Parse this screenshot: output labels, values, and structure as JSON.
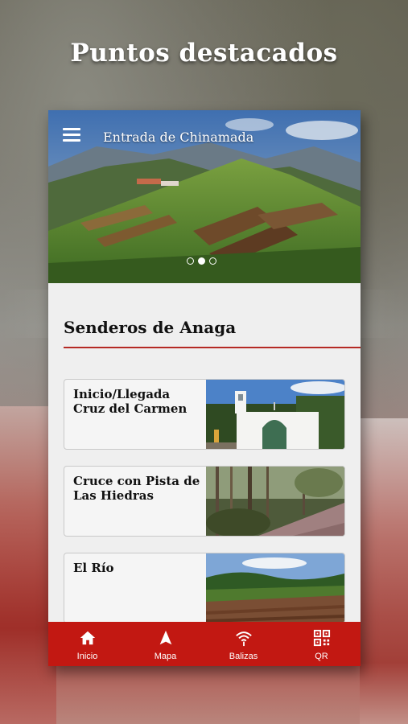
{
  "page": {
    "heading": "Puntos destacados"
  },
  "header": {
    "title": "Entrada de Chinamada",
    "menu_icon": "menu-icon"
  },
  "carousel": {
    "count": 3,
    "active_index": 1
  },
  "section": {
    "title": "Senderos de Anaga"
  },
  "cards": [
    {
      "title": "Inicio/Llegada Cruz del Carmen",
      "image": "chapel-image"
    },
    {
      "title": "Cruce con Pista de Las Hiedras",
      "image": "forest-path-image"
    },
    {
      "title": "El Río",
      "image": "terraced-field-image"
    }
  ],
  "nav": {
    "items": [
      {
        "label": "Inicio",
        "icon": "home-icon"
      },
      {
        "label": "Mapa",
        "icon": "navigation-arrow-icon"
      },
      {
        "label": "Balizas",
        "icon": "wifi-signal-icon"
      },
      {
        "label": "QR",
        "icon": "qr-code-icon"
      }
    ]
  },
  "colors": {
    "accent": "#c21812",
    "rule": "#b52a24",
    "surface": "#efefef"
  }
}
